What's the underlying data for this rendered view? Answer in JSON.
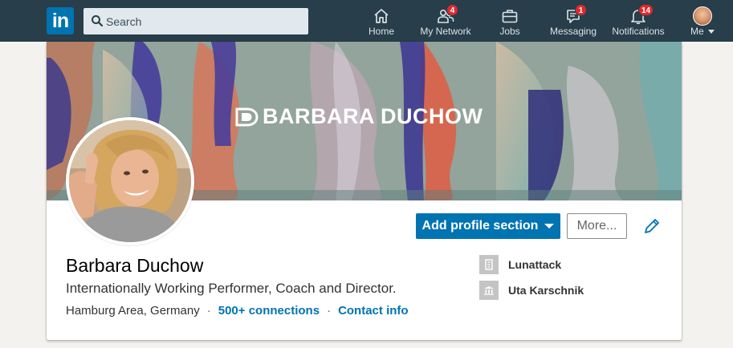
{
  "nav": {
    "logo_text": "in",
    "search": {
      "placeholder": "Search"
    },
    "items": [
      {
        "label": "Home",
        "icon": "home-icon"
      },
      {
        "label": "My Network",
        "icon": "network-icon",
        "badge": "4"
      },
      {
        "label": "Jobs",
        "icon": "briefcase-icon"
      },
      {
        "label": "Messaging",
        "icon": "messaging-icon",
        "badge": "1"
      },
      {
        "label": "Notifications",
        "icon": "bell-icon",
        "badge": "14"
      },
      {
        "label": "Me",
        "icon": "avatar"
      }
    ]
  },
  "profile": {
    "cover_text": "BARBARA DUCHOW",
    "name": "Barbara Duchow",
    "headline": "Internationally Working Performer, Coach and Director.",
    "location": "Hamburg Area, Germany",
    "separator": "·",
    "connections": "500+ connections",
    "contact": "Contact info",
    "actions": {
      "add_section": "Add profile section",
      "more": "More..."
    },
    "experience": [
      {
        "name": "Lunattack",
        "icon": "building-icon"
      },
      {
        "name": "Uta Karschnik",
        "icon": "school-icon"
      }
    ]
  },
  "colors": {
    "nav_bg": "#283e4a",
    "brand": "#0073b1",
    "badge": "#e0292d",
    "page_bg": "#f3f2ef"
  }
}
